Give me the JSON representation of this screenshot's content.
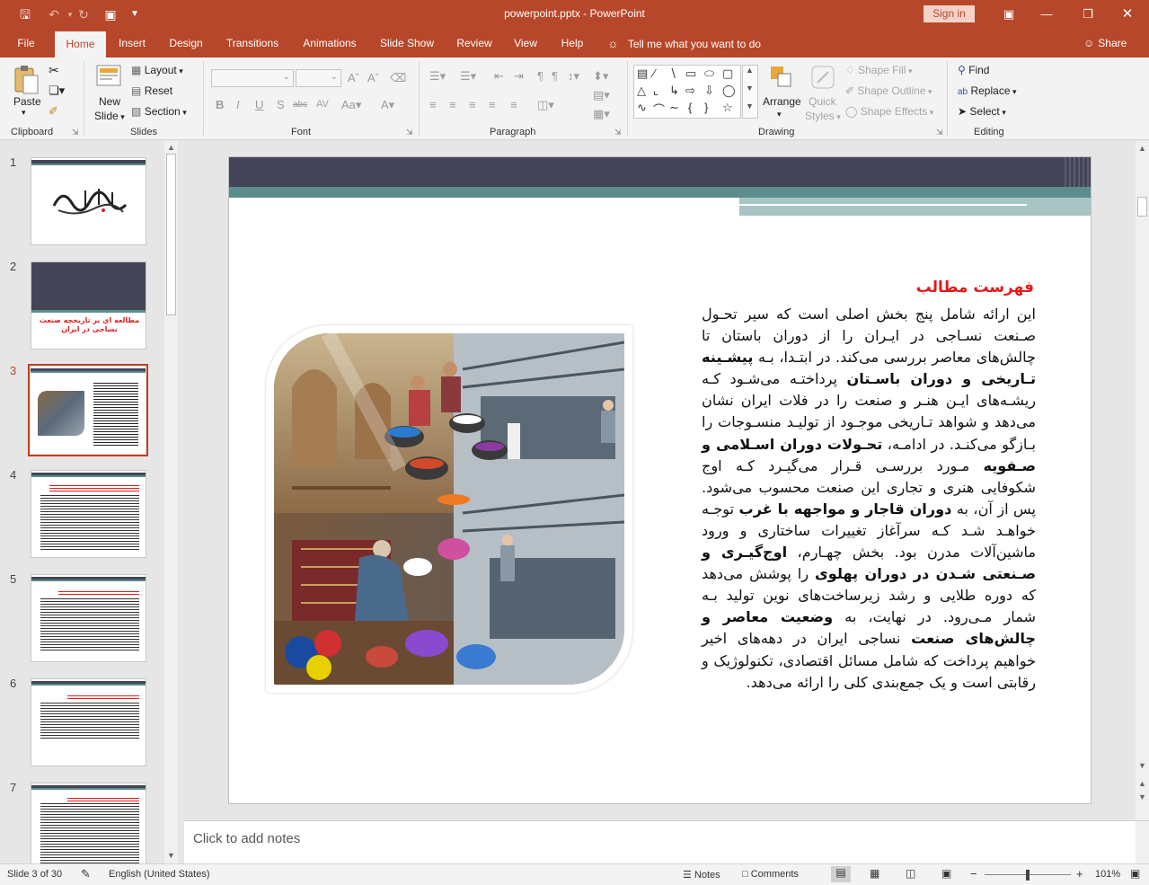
{
  "titlebar": {
    "title": "powerpoint.pptx  -  PowerPoint",
    "signin": "Sign in"
  },
  "tabs": [
    "File",
    "Home",
    "Insert",
    "Design",
    "Transitions",
    "Animations",
    "Slide Show",
    "Review",
    "View",
    "Help"
  ],
  "tellme": "Tell me what you want to do",
  "share": "Share",
  "ribbon": {
    "clipboard": {
      "label": "Clipboard",
      "paste": "Paste"
    },
    "slides": {
      "label": "Slides",
      "new_slide_1": "New",
      "new_slide_2": "Slide",
      "layout": "Layout",
      "reset": "Reset",
      "section": "Section"
    },
    "font": {
      "label": "Font"
    },
    "paragraph": {
      "label": "Paragraph"
    },
    "drawing": {
      "label": "Drawing",
      "arrange": "Arrange",
      "quick_styles_1": "Quick",
      "quick_styles_2": "Styles",
      "shape_fill": "Shape Fill",
      "shape_outline": "Shape Outline",
      "shape_effects": "Shape Effects"
    },
    "editing": {
      "label": "Editing",
      "find": "Find",
      "replace": "Replace",
      "select": "Select"
    }
  },
  "thumbnails": [
    "1",
    "2",
    "3",
    "4",
    "5",
    "6",
    "7"
  ],
  "thumb2_text": "مطالعه ای بر تاریخچه صنعت نساجی در ایران",
  "slide": {
    "title": "فهرست مطالب",
    "body_1": "این ارائه شامل پنج بخش اصلی است که سیر تحـول صـنعت نسـاجی در ایـران را از دوران باستان تا چالش‌های معاصر بررسی می‌کند. در ابتـدا، بـه ",
    "bold_1": "پیشـینه تـاریخی و دوران باسـتان",
    "body_2": " پرداختـه می‌شـود کـه ریشـه‌های ایـن هنـر و صنعت را در فلات ایران نشان می‌دهد و شواهد تـاریخی موجـود از تولیـد منسـوجات را بـازگو می‌کنـد. در ادامـه، ",
    "bold_2": "تحـولات دوران اسـلامی و صـفویه",
    "body_3": " مـورد بررسـی قـرار می‌گیـرد کـه اوج شکوفایی هنری و تجاری این صنعت محسوب می‌شود. پس از آن، به ",
    "bold_3": "دوران قاجار و مواجهه با غرب",
    "body_4": " توجـه خواهـد شـد کـه سرآغاز تغییرات ساختاری و ورود ماشین‌آلات مدرن بود. بخش چهـارم، ",
    "bold_4": "اوج‌گیـری و صـنعتی شـدن در دوران پهلوی",
    "body_5": " را پوشش می‌دهد که دوره طلایی و رشد زیرساخت‌های نوین تولید بـه شمار مـی‌رود. در نهایت، به ",
    "bold_5": "وضعیت معاصر و چالش‌های صنعت",
    "body_6": " نساجی ایران در دهه‌های اخیر خواهیم پرداخت که شامل مسائل اقتصادی، تکنولوژیک و رقابتی است و یک جمع‌بندی کلی را ارائه می‌دهد."
  },
  "notes": "Click to add notes",
  "status": {
    "slide_of": "Slide 3 of 30",
    "language": "English (United States)",
    "notes": "Notes",
    "comments": "Comments",
    "zoom": "101%"
  },
  "colors": {
    "accent": "#b7472a",
    "slide_header": "#434556",
    "slide_band": "#5b8d8c",
    "title_red": "#e21b1b"
  }
}
